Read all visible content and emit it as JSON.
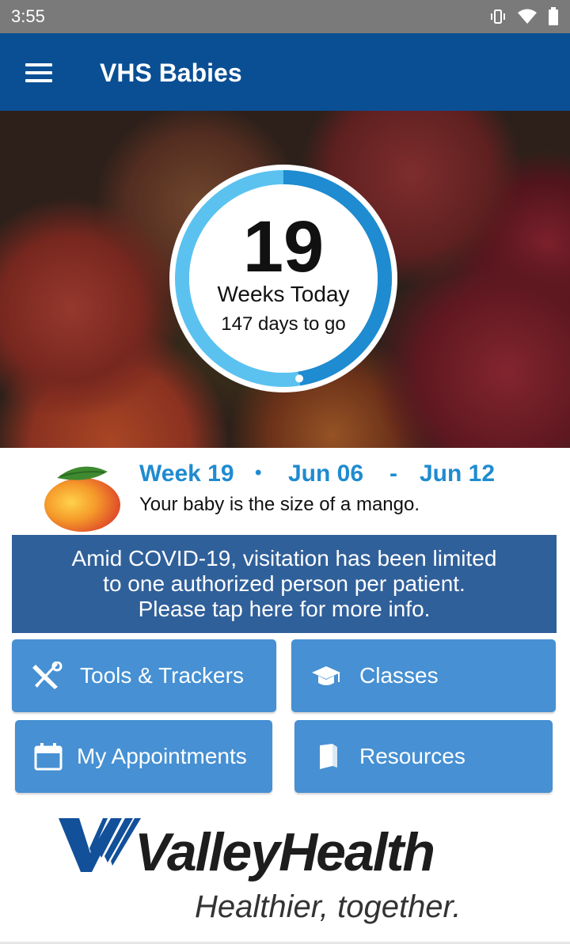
{
  "status_bar": {
    "time": "3:55",
    "icons": [
      "vibrate-icon",
      "wifi-icon",
      "battery-icon"
    ]
  },
  "app_bar": {
    "title": "VHS Babies",
    "menu_icon": "hamburger-menu-icon"
  },
  "progress": {
    "weeks": "19",
    "weeks_label": "Weeks Today",
    "days_to_go": "147 days to go",
    "fraction_complete": 0.475
  },
  "week_info": {
    "week": "Week 19",
    "separator": "•",
    "start": "Jun 06",
    "dash": "-",
    "end": "Jun 12",
    "size_text": "Your baby is the size of a mango.",
    "accent_color": "#1f8bd0"
  },
  "covid_banner": {
    "line1": "Amid COVID-19, visitation has been limited",
    "line2": "to one authorized person per patient.",
    "line3": "Please tap here for more info.",
    "color": "#30609a"
  },
  "buttons": {
    "tools": {
      "label": "Tools & Trackers",
      "icon": "tools-icon"
    },
    "classes": {
      "label": "Classes",
      "icon": "graduation-cap-icon"
    },
    "appointments": {
      "label": "My Appointments",
      "icon": "calendar-icon"
    },
    "resources": {
      "label": "Resources",
      "icon": "book-icon"
    },
    "color": "#4690d3"
  },
  "logo": {
    "name": "ValleyHealth",
    "tagline": "Healthier, together."
  },
  "colors": {
    "app_bar": "#0a4f94",
    "ring_progress": "#1f8bd0",
    "ring_track": "#5bc2f0"
  }
}
